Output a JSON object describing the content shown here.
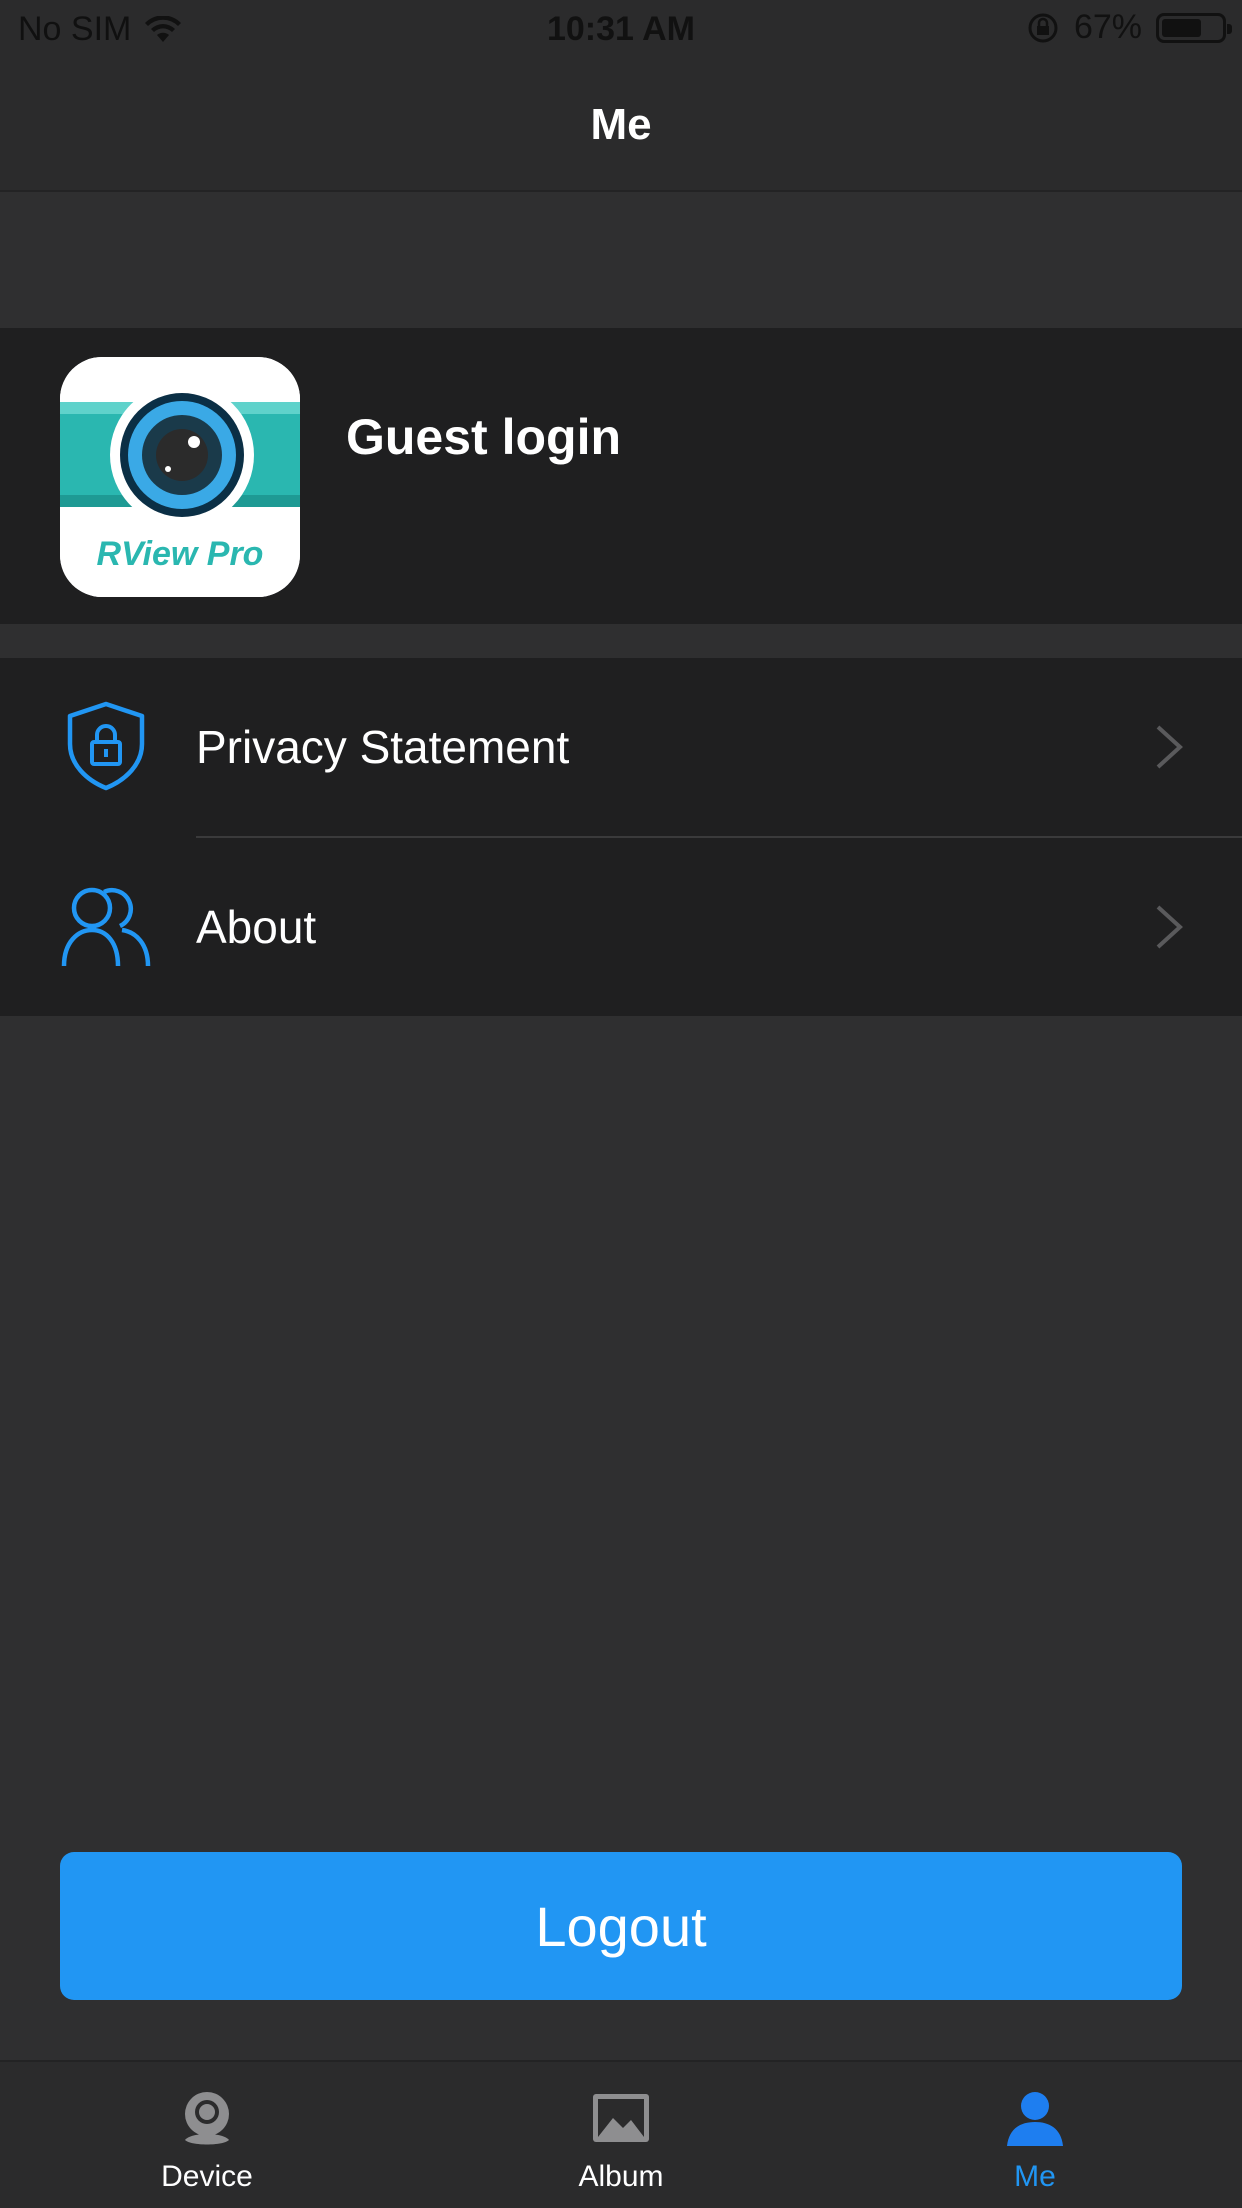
{
  "status_bar": {
    "carrier": "No SIM",
    "time": "10:31 AM",
    "battery_percent": "67%",
    "battery_level": 0.67
  },
  "nav": {
    "title": "Me"
  },
  "profile": {
    "logo_text": "RView Pro",
    "name": "Guest login"
  },
  "menu": {
    "items": [
      {
        "label": "Privacy Statement",
        "icon": "shield-lock-icon"
      },
      {
        "label": "About",
        "icon": "users-icon"
      }
    ]
  },
  "logout": {
    "label": "Logout"
  },
  "tabs": [
    {
      "label": "Device",
      "icon": "camera-icon",
      "active": false
    },
    {
      "label": "Album",
      "icon": "image-icon",
      "active": false
    },
    {
      "label": "Me",
      "icon": "person-icon",
      "active": true
    }
  ],
  "colors": {
    "accent": "#2196f3",
    "background": "#2f2f30",
    "card": "#1f1f20",
    "logo_teal": "#2ab7b0"
  }
}
